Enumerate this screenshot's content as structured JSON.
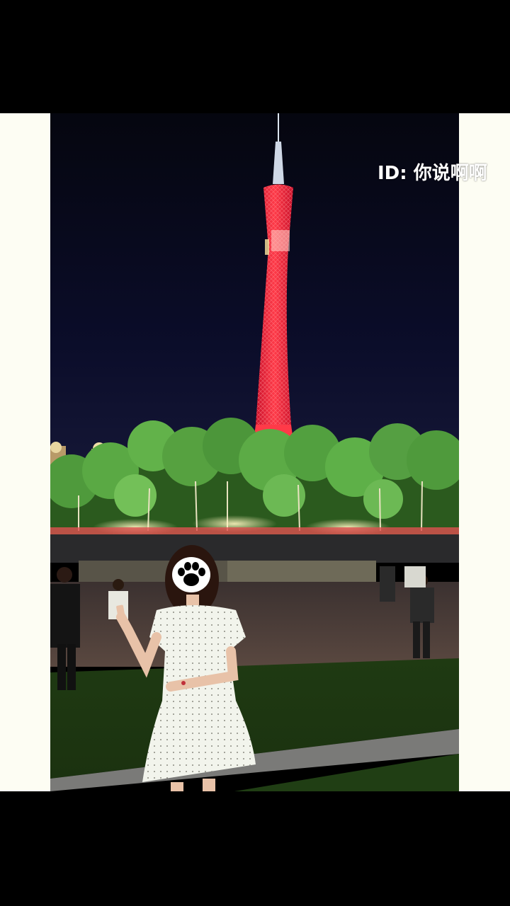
{
  "overlay": {
    "watermark_text": "ID: 你说啊啊"
  },
  "photo": {
    "subject": "night-tower-portrait",
    "sticker_icon": "paw-icon"
  },
  "colors": {
    "frame_side": "#fdfdf3",
    "letterbox": "#000000",
    "sky": "#0a0c25",
    "tower": "#ff2a3a",
    "trees": "#4fa64a",
    "dress": "#f2f4ec"
  }
}
